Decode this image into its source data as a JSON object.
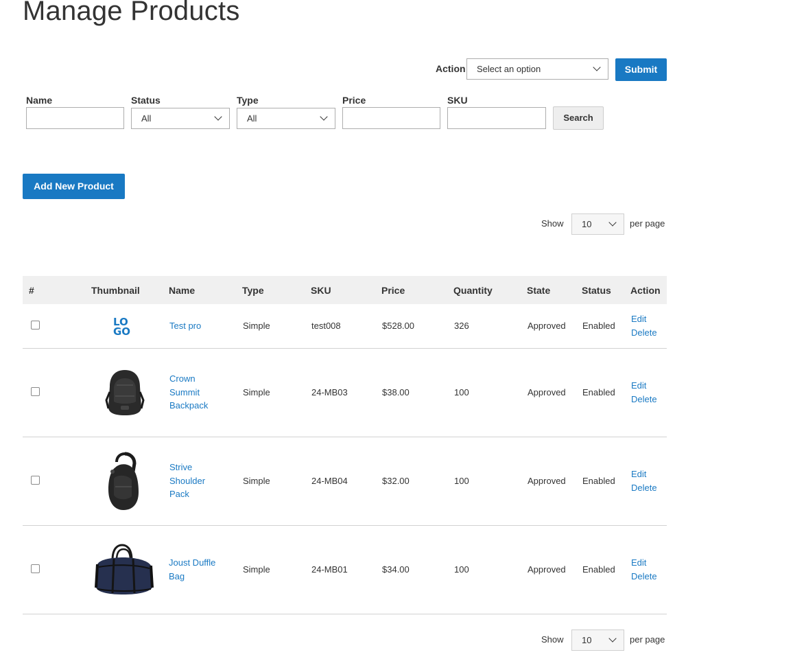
{
  "page": {
    "title": "Manage Products"
  },
  "mass_action": {
    "label": "Action",
    "select_value": "Select an option",
    "submit_label": "Submit"
  },
  "filters": {
    "name_label": "Name",
    "status_label": "Status",
    "status_value": "All",
    "type_label": "Type",
    "type_value": "All",
    "price_label": "Price",
    "sku_label": "SKU",
    "search_label": "Search"
  },
  "add_button": "Add New Product",
  "pager_top": {
    "show_label": "Show",
    "value": "10",
    "per_page_label": "per page"
  },
  "pager_bottom": {
    "show_label": "Show",
    "value": "10",
    "per_page_label": "per page"
  },
  "table": {
    "headers": [
      "#",
      "Thumbnail",
      "Name",
      "Type",
      "SKU",
      "Price",
      "Quantity",
      "State",
      "Status",
      "Action"
    ],
    "rows": [
      {
        "thumb": "logo-image",
        "name": "Test pro",
        "type": "Simple",
        "sku": "test008",
        "price": "$528.00",
        "quantity": "326",
        "state": "Approved",
        "status": "Enabled",
        "edit": "Edit",
        "delete": "Delete"
      },
      {
        "thumb": "backpack-image",
        "name": "Crown Summit Backpack",
        "type": "Simple",
        "sku": "24-MB03",
        "price": "$38.00",
        "quantity": "100",
        "state": "Approved",
        "status": "Enabled",
        "edit": "Edit",
        "delete": "Delete"
      },
      {
        "thumb": "sling-pack-image",
        "name": "Strive Shoulder Pack",
        "type": "Simple",
        "sku": "24-MB04",
        "price": "$32.00",
        "quantity": "100",
        "state": "Approved",
        "status": "Enabled",
        "edit": "Edit",
        "delete": "Delete"
      },
      {
        "thumb": "duffle-bag-image",
        "name": "Joust Duffle Bag",
        "type": "Simple",
        "sku": "24-MB01",
        "price": "$34.00",
        "quantity": "100",
        "state": "Approved",
        "status": "Enabled",
        "edit": "Edit",
        "delete": "Delete"
      }
    ]
  },
  "logo_text": "LOGO",
  "colors": {
    "accent": "#1979c3",
    "header_bg": "#f0f0f0"
  }
}
